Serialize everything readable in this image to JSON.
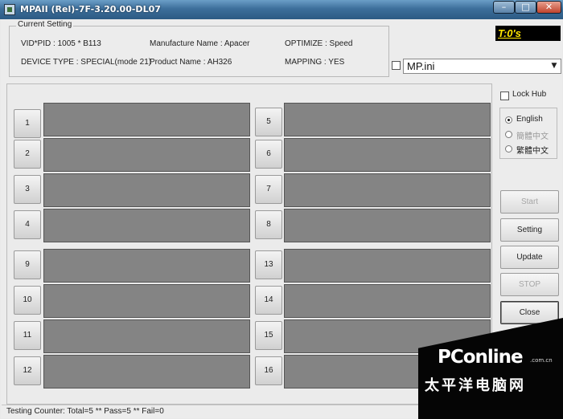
{
  "window": {
    "title": "MPAII (Rel)-7F-3.20.00-DL07",
    "minimize_label": "–",
    "maximize_label": "□",
    "close_label": "✕"
  },
  "current_setting": {
    "legend": "Current Setting",
    "vid_pid": "VID*PID : 1005 * B113",
    "device_type": "DEVICE TYPE : SPECIAL(mode 21)",
    "manufacture_name": "Manufacture Name : Apacer",
    "product_name": "Product Name : AH326",
    "optimize": "OPTIMIZE : Speed",
    "mapping": "MAPPING : YES"
  },
  "timer": "T:0's",
  "ini_combo": {
    "value": "MP.ini",
    "arrow": "▼"
  },
  "ports": [
    {
      "num": "1"
    },
    {
      "num": "2"
    },
    {
      "num": "3"
    },
    {
      "num": "4"
    },
    {
      "num": "5"
    },
    {
      "num": "6"
    },
    {
      "num": "7"
    },
    {
      "num": "8"
    },
    {
      "num": "9"
    },
    {
      "num": "10"
    },
    {
      "num": "11"
    },
    {
      "num": "12"
    },
    {
      "num": "13"
    },
    {
      "num": "14"
    },
    {
      "num": "15"
    },
    {
      "num": "16"
    }
  ],
  "lock_hub": "Lock Hub",
  "languages": [
    {
      "label": "English",
      "selected": true
    },
    {
      "label": "簡體中文",
      "selected": false
    },
    {
      "label": "繁體中文",
      "selected": false
    }
  ],
  "buttons": {
    "start": "Start",
    "setting": "Setting",
    "update": "Update",
    "stop": "STOP",
    "close": "Close"
  },
  "status": "Testing Counter: Total=5 ** Pass=5 ** Fail=0",
  "watermark": {
    "brand": "PConline",
    "domain": ".com.cn",
    "cn": "太平洋电脑网"
  }
}
